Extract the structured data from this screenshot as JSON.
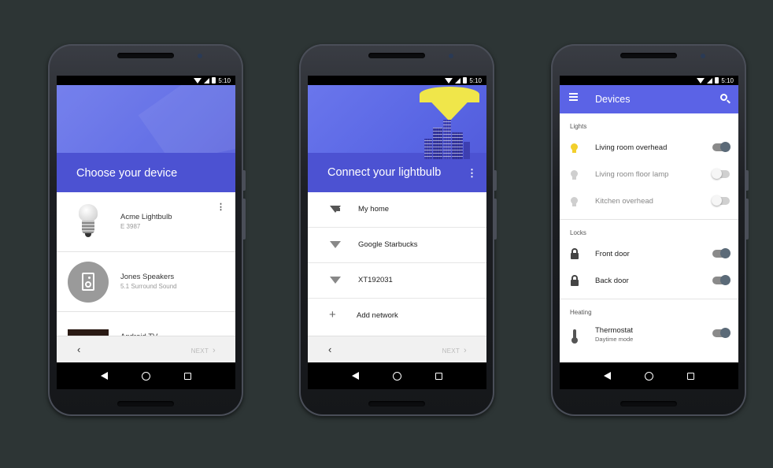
{
  "status": {
    "time": "5:10"
  },
  "phone1": {
    "title": "Choose your device",
    "devices": [
      {
        "name": "Acme Lightbulb",
        "sub": "E 3987"
      },
      {
        "name": "Jones Speakers",
        "sub": "5.1 Surround Sound"
      },
      {
        "name": "Android TV",
        "sub": ""
      }
    ],
    "next_label": "NEXT",
    "back_glyph": "‹",
    "next_glyph": "›"
  },
  "phone2": {
    "title": "Connect your lightbulb",
    "networks": [
      {
        "label": "My home"
      },
      {
        "label": "Google Starbucks"
      },
      {
        "label": "XT192031"
      }
    ],
    "add_network": "Add network",
    "next_label": "NEXT"
  },
  "phone3": {
    "title": "Devices",
    "sections": {
      "lights": "Lights",
      "locks": "Locks",
      "heating": "Heating"
    },
    "lights": [
      {
        "label": "Living room overhead",
        "on": true
      },
      {
        "label": "Living room floor lamp",
        "on": false
      },
      {
        "label": "Kitchen overhead",
        "on": false
      }
    ],
    "locks": [
      {
        "label": "Front door",
        "on": true
      },
      {
        "label": "Back door",
        "on": true
      }
    ],
    "heating": [
      {
        "label": "Thermostat",
        "sub": "Daytime mode",
        "on": true
      }
    ]
  },
  "icons": {
    "more": "more-vert-icon",
    "wifi": "wifi-icon",
    "add": "plus-icon",
    "menu": "hamburger-icon",
    "search": "search-icon",
    "light": "lightbulb-icon",
    "lock": "lock-icon",
    "thermostat": "thermometer-icon"
  },
  "colors": {
    "primary": "#5b63e6",
    "accent_yellow": "#f2cf2c",
    "background": "#2d3535"
  }
}
